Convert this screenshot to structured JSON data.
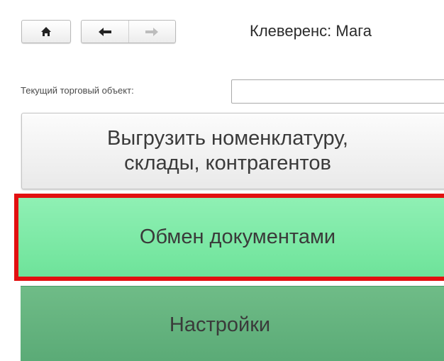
{
  "toolbar": {
    "home_icon": "home-icon",
    "back_icon": "arrow-left-icon",
    "forward_icon": "arrow-right-icon"
  },
  "header": {
    "title": "Клеверенс: Мага"
  },
  "form": {
    "current_object_label": "Текущий торговый объект:",
    "current_object_value": ""
  },
  "buttons": {
    "export_line1": "Выгрузить номенклатуру,",
    "export_line2": "склады, контрагентов",
    "exchange_label": "Обмен документами",
    "settings_label": "Настройки"
  },
  "colors": {
    "highlight_border": "#e21010",
    "exchange_bg": "#7ee8a6",
    "settings_bg": "#64b37e"
  }
}
